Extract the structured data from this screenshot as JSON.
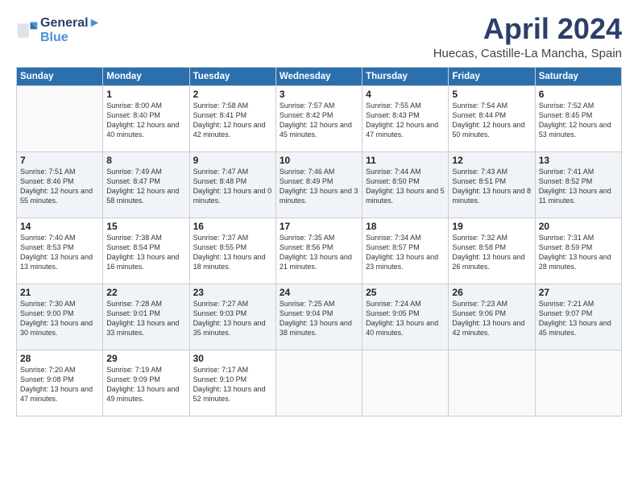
{
  "header": {
    "logo_line1": "General",
    "logo_line2": "Blue",
    "title": "April 2024",
    "location": "Huecas, Castille-La Mancha, Spain"
  },
  "weekdays": [
    "Sunday",
    "Monday",
    "Tuesday",
    "Wednesday",
    "Thursday",
    "Friday",
    "Saturday"
  ],
  "weeks": [
    [
      {
        "num": "",
        "sunrise": "",
        "sunset": "",
        "daylight": ""
      },
      {
        "num": "1",
        "sunrise": "Sunrise: 8:00 AM",
        "sunset": "Sunset: 8:40 PM",
        "daylight": "Daylight: 12 hours and 40 minutes."
      },
      {
        "num": "2",
        "sunrise": "Sunrise: 7:58 AM",
        "sunset": "Sunset: 8:41 PM",
        "daylight": "Daylight: 12 hours and 42 minutes."
      },
      {
        "num": "3",
        "sunrise": "Sunrise: 7:57 AM",
        "sunset": "Sunset: 8:42 PM",
        "daylight": "Daylight: 12 hours and 45 minutes."
      },
      {
        "num": "4",
        "sunrise": "Sunrise: 7:55 AM",
        "sunset": "Sunset: 8:43 PM",
        "daylight": "Daylight: 12 hours and 47 minutes."
      },
      {
        "num": "5",
        "sunrise": "Sunrise: 7:54 AM",
        "sunset": "Sunset: 8:44 PM",
        "daylight": "Daylight: 12 hours and 50 minutes."
      },
      {
        "num": "6",
        "sunrise": "Sunrise: 7:52 AM",
        "sunset": "Sunset: 8:45 PM",
        "daylight": "Daylight: 12 hours and 53 minutes."
      }
    ],
    [
      {
        "num": "7",
        "sunrise": "Sunrise: 7:51 AM",
        "sunset": "Sunset: 8:46 PM",
        "daylight": "Daylight: 12 hours and 55 minutes."
      },
      {
        "num": "8",
        "sunrise": "Sunrise: 7:49 AM",
        "sunset": "Sunset: 8:47 PM",
        "daylight": "Daylight: 12 hours and 58 minutes."
      },
      {
        "num": "9",
        "sunrise": "Sunrise: 7:47 AM",
        "sunset": "Sunset: 8:48 PM",
        "daylight": "Daylight: 13 hours and 0 minutes."
      },
      {
        "num": "10",
        "sunrise": "Sunrise: 7:46 AM",
        "sunset": "Sunset: 8:49 PM",
        "daylight": "Daylight: 13 hours and 3 minutes."
      },
      {
        "num": "11",
        "sunrise": "Sunrise: 7:44 AM",
        "sunset": "Sunset: 8:50 PM",
        "daylight": "Daylight: 13 hours and 5 minutes."
      },
      {
        "num": "12",
        "sunrise": "Sunrise: 7:43 AM",
        "sunset": "Sunset: 8:51 PM",
        "daylight": "Daylight: 13 hours and 8 minutes."
      },
      {
        "num": "13",
        "sunrise": "Sunrise: 7:41 AM",
        "sunset": "Sunset: 8:52 PM",
        "daylight": "Daylight: 13 hours and 11 minutes."
      }
    ],
    [
      {
        "num": "14",
        "sunrise": "Sunrise: 7:40 AM",
        "sunset": "Sunset: 8:53 PM",
        "daylight": "Daylight: 13 hours and 13 minutes."
      },
      {
        "num": "15",
        "sunrise": "Sunrise: 7:38 AM",
        "sunset": "Sunset: 8:54 PM",
        "daylight": "Daylight: 13 hours and 16 minutes."
      },
      {
        "num": "16",
        "sunrise": "Sunrise: 7:37 AM",
        "sunset": "Sunset: 8:55 PM",
        "daylight": "Daylight: 13 hours and 18 minutes."
      },
      {
        "num": "17",
        "sunrise": "Sunrise: 7:35 AM",
        "sunset": "Sunset: 8:56 PM",
        "daylight": "Daylight: 13 hours and 21 minutes."
      },
      {
        "num": "18",
        "sunrise": "Sunrise: 7:34 AM",
        "sunset": "Sunset: 8:57 PM",
        "daylight": "Daylight: 13 hours and 23 minutes."
      },
      {
        "num": "19",
        "sunrise": "Sunrise: 7:32 AM",
        "sunset": "Sunset: 8:58 PM",
        "daylight": "Daylight: 13 hours and 26 minutes."
      },
      {
        "num": "20",
        "sunrise": "Sunrise: 7:31 AM",
        "sunset": "Sunset: 8:59 PM",
        "daylight": "Daylight: 13 hours and 28 minutes."
      }
    ],
    [
      {
        "num": "21",
        "sunrise": "Sunrise: 7:30 AM",
        "sunset": "Sunset: 9:00 PM",
        "daylight": "Daylight: 13 hours and 30 minutes."
      },
      {
        "num": "22",
        "sunrise": "Sunrise: 7:28 AM",
        "sunset": "Sunset: 9:01 PM",
        "daylight": "Daylight: 13 hours and 33 minutes."
      },
      {
        "num": "23",
        "sunrise": "Sunrise: 7:27 AM",
        "sunset": "Sunset: 9:03 PM",
        "daylight": "Daylight: 13 hours and 35 minutes."
      },
      {
        "num": "24",
        "sunrise": "Sunrise: 7:25 AM",
        "sunset": "Sunset: 9:04 PM",
        "daylight": "Daylight: 13 hours and 38 minutes."
      },
      {
        "num": "25",
        "sunrise": "Sunrise: 7:24 AM",
        "sunset": "Sunset: 9:05 PM",
        "daylight": "Daylight: 13 hours and 40 minutes."
      },
      {
        "num": "26",
        "sunrise": "Sunrise: 7:23 AM",
        "sunset": "Sunset: 9:06 PM",
        "daylight": "Daylight: 13 hours and 42 minutes."
      },
      {
        "num": "27",
        "sunrise": "Sunrise: 7:21 AM",
        "sunset": "Sunset: 9:07 PM",
        "daylight": "Daylight: 13 hours and 45 minutes."
      }
    ],
    [
      {
        "num": "28",
        "sunrise": "Sunrise: 7:20 AM",
        "sunset": "Sunset: 9:08 PM",
        "daylight": "Daylight: 13 hours and 47 minutes."
      },
      {
        "num": "29",
        "sunrise": "Sunrise: 7:19 AM",
        "sunset": "Sunset: 9:09 PM",
        "daylight": "Daylight: 13 hours and 49 minutes."
      },
      {
        "num": "30",
        "sunrise": "Sunrise: 7:17 AM",
        "sunset": "Sunset: 9:10 PM",
        "daylight": "Daylight: 13 hours and 52 minutes."
      },
      {
        "num": "",
        "sunrise": "",
        "sunset": "",
        "daylight": ""
      },
      {
        "num": "",
        "sunrise": "",
        "sunset": "",
        "daylight": ""
      },
      {
        "num": "",
        "sunrise": "",
        "sunset": "",
        "daylight": ""
      },
      {
        "num": "",
        "sunrise": "",
        "sunset": "",
        "daylight": ""
      }
    ]
  ]
}
